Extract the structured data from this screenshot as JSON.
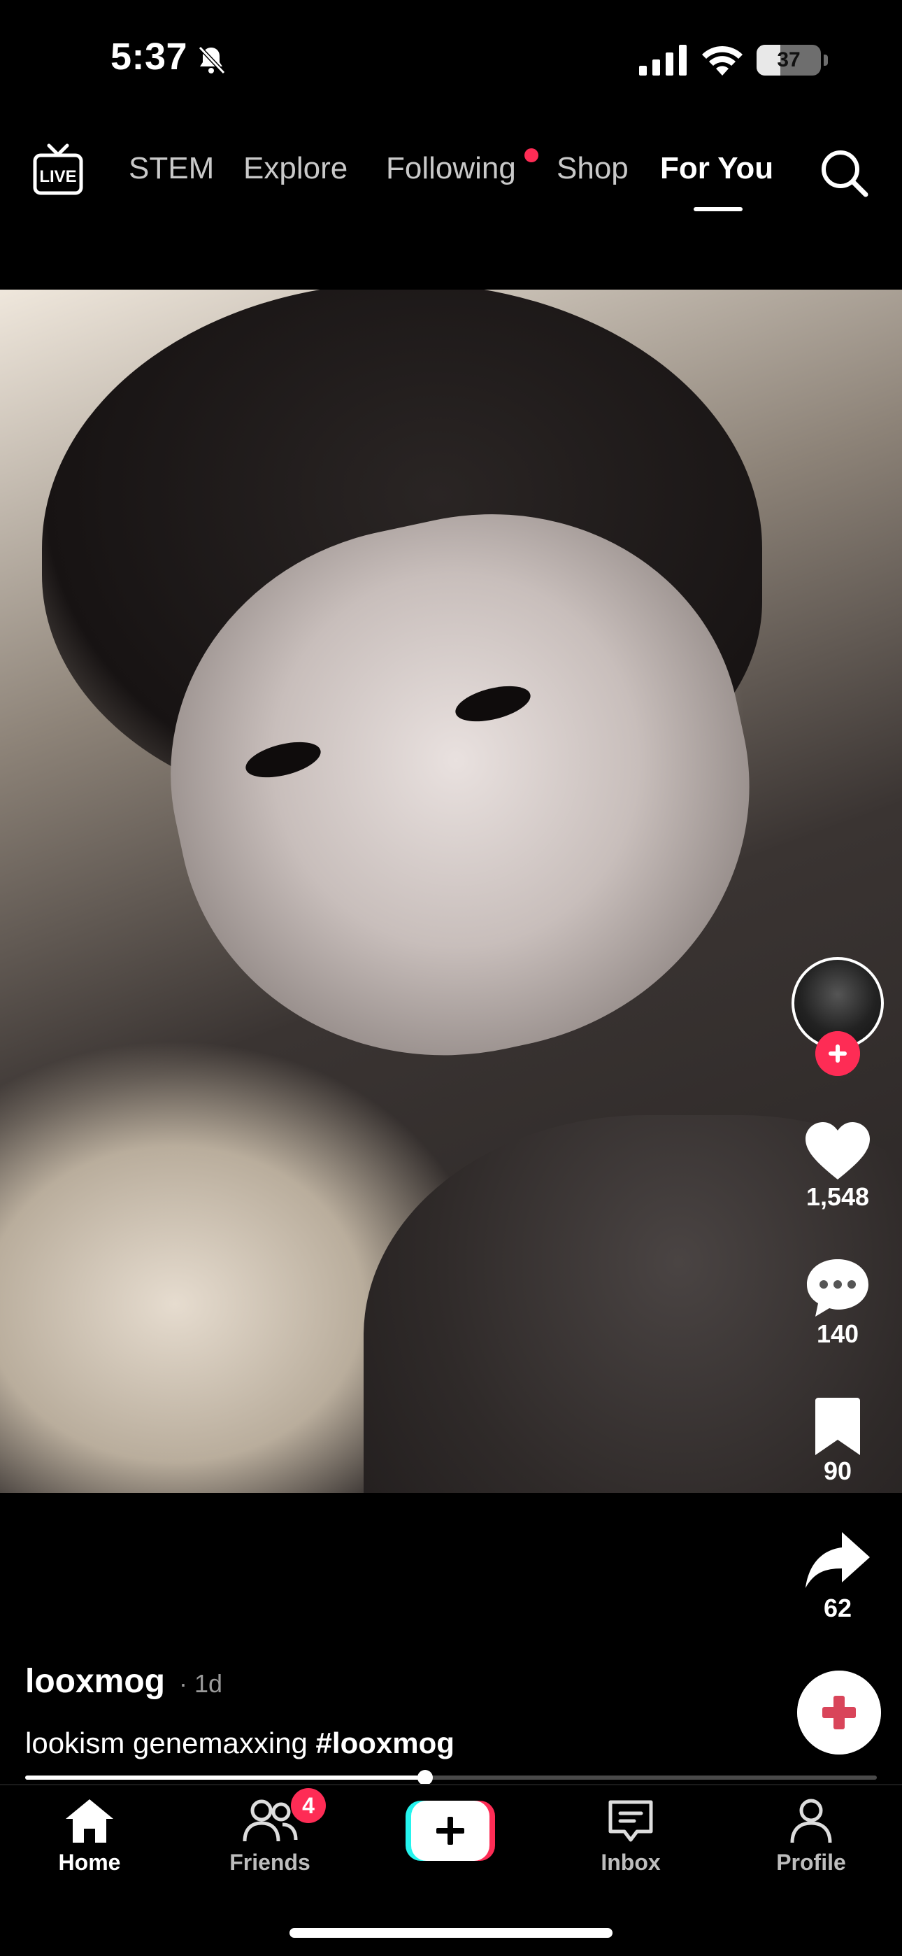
{
  "status_bar": {
    "time": "5:37",
    "battery_level": "37",
    "battery_fraction": 0.37
  },
  "top_nav": {
    "tabs": [
      {
        "label": "STEM"
      },
      {
        "label": "Explore"
      },
      {
        "label": "Following"
      },
      {
        "label": "Shop"
      },
      {
        "label": "For You"
      }
    ],
    "active_tab": "For You"
  },
  "video": {
    "actions": {
      "likes": "1,548",
      "comments": "140",
      "bookmarks": "90",
      "shares": "62"
    },
    "author": {
      "username": "looxmog",
      "time_ago": "· 1d"
    },
    "caption": {
      "text": "lookism genemaxxing",
      "hashtag": "#looxmog"
    },
    "progress": 0.47
  },
  "bottom_nav": {
    "items": [
      {
        "label": "Home"
      },
      {
        "label": "Friends"
      },
      {
        "label": "Inbox"
      },
      {
        "label": "Profile"
      }
    ],
    "friends_badge": "4",
    "active": "Home"
  },
  "colors": {
    "accent": "#fe2c55",
    "background": "#000000",
    "create_cyan": "#25f4ee",
    "create_red": "#fe2c55"
  }
}
